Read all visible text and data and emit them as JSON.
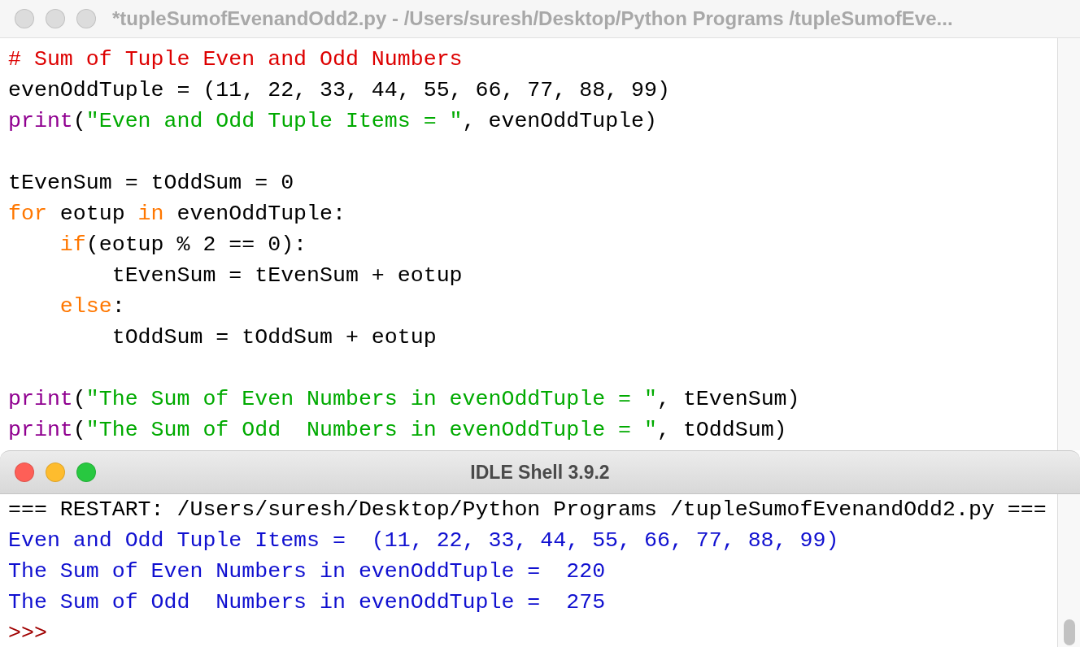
{
  "editor": {
    "title": "*tupleSumofEvenandOdd2.py - /Users/suresh/Desktop/Python Programs /tupleSumofEve...",
    "active": false,
    "lines": [
      {
        "kind": "code",
        "segments": [
          {
            "text": "# Sum of Tuple Even and Odd Numbers",
            "kind": "comment"
          }
        ]
      },
      {
        "kind": "code",
        "segments": [
          {
            "text": "evenOddTuple = (11, 22, 33, 44, 55, 66, 77, 88, 99)",
            "kind": "plain"
          }
        ]
      },
      {
        "kind": "code",
        "segments": [
          {
            "text": "print",
            "kind": "builtin"
          },
          {
            "text": "(",
            "kind": "plain"
          },
          {
            "text": "\"Even and Odd Tuple Items = \"",
            "kind": "string"
          },
          {
            "text": ", evenOddTuple)",
            "kind": "plain"
          }
        ]
      },
      {
        "kind": "blank"
      },
      {
        "kind": "code",
        "segments": [
          {
            "text": "tEvenSum = tOddSum = 0",
            "kind": "plain"
          }
        ]
      },
      {
        "kind": "code",
        "segments": [
          {
            "text": "for",
            "kind": "keyword"
          },
          {
            "text": " eotup ",
            "kind": "plain"
          },
          {
            "text": "in",
            "kind": "keyword"
          },
          {
            "text": " evenOddTuple:",
            "kind": "plain"
          }
        ]
      },
      {
        "kind": "indented",
        "segments": [
          {
            "text": "if",
            "kind": "keyword"
          },
          {
            "text": "(eotup % 2 == 0):",
            "kind": "plain"
          }
        ]
      },
      {
        "kind": "code",
        "segments": [
          {
            "text": "        tEvenSum = tEvenSum + eotup",
            "kind": "plain"
          }
        ]
      },
      {
        "kind": "indented",
        "segments": [
          {
            "text": "else",
            "kind": "keyword"
          },
          {
            "text": ":",
            "kind": "plain"
          }
        ]
      },
      {
        "kind": "code",
        "segments": [
          {
            "text": "        tOddSum = tOddSum + eotup",
            "kind": "plain"
          }
        ]
      },
      {
        "kind": "blank"
      },
      {
        "kind": "code",
        "segments": [
          {
            "text": "print",
            "kind": "builtin"
          },
          {
            "text": "(",
            "kind": "plain"
          },
          {
            "text": "\"The Sum of Even Numbers in evenOddTuple = \"",
            "kind": "string"
          },
          {
            "text": ", tEvenSum)",
            "kind": "plain"
          }
        ]
      },
      {
        "kind": "code",
        "segments": [
          {
            "text": "print",
            "kind": "builtin"
          },
          {
            "text": "(",
            "kind": "plain"
          },
          {
            "text": "\"The Sum of Odd  Numbers in evenOddTuple = \"",
            "kind": "string"
          },
          {
            "text": ", tOddSum)",
            "kind": "plain"
          }
        ]
      }
    ]
  },
  "shell": {
    "title": "IDLE Shell 3.9.2",
    "active": true,
    "lines": [
      {
        "text": "=== RESTART: /Users/suresh/Desktop/Python Programs /tupleSumofEvenandOdd2.py ===",
        "kind": "console"
      },
      {
        "text": "Even and Odd Tuple Items =  (11, 22, 33, 44, 55, 66, 77, 88, 99)",
        "kind": "stdout"
      },
      {
        "text": "The Sum of Even Numbers in evenOddTuple =  220",
        "kind": "stdout"
      },
      {
        "text": "The Sum of Odd  Numbers in evenOddTuple =  275",
        "kind": "stdout"
      },
      {
        "text": ">>>",
        "kind": "prompt"
      }
    ]
  }
}
